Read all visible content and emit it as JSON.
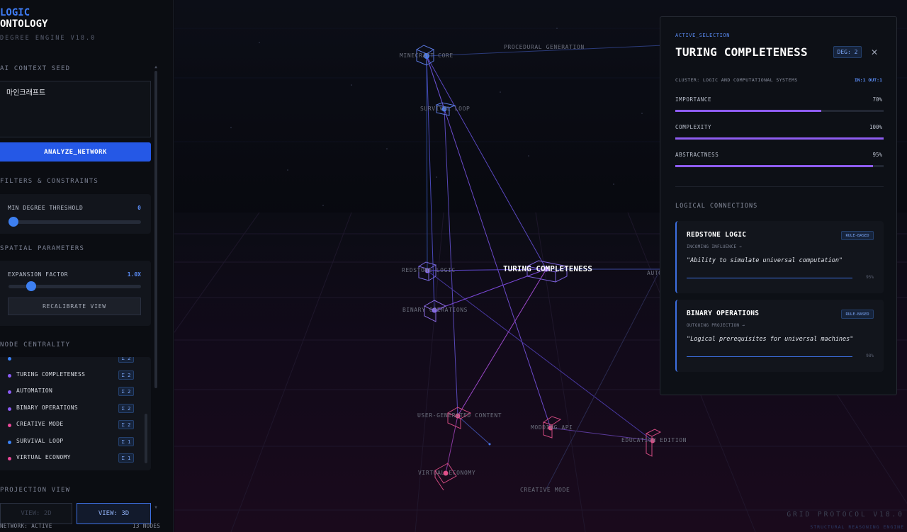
{
  "brand": {
    "line1": "LOGIC",
    "line2": "ONTOLOGY",
    "line3": "DEGREE ENGINE V18.0"
  },
  "sidebar": {
    "seed_title": "AI CONTEXT SEED",
    "seed_value": "마인크래프트",
    "analyze_label": "ANALYZE_NETWORK",
    "filters_title": "FILTERS & CONSTRAINTS",
    "min_degree_label": "MIN DEGREE THRESHOLD",
    "min_degree_value": "0",
    "spatial_title": "SPATIAL PARAMETERS",
    "expansion_label": "EXPANSION FACTOR",
    "expansion_value": "1.0X",
    "recalibrate_label": "RECALIBRATE VIEW",
    "centrality_title": "NODE CENTRALITY",
    "centrality": [
      {
        "label": "TURING COMPLETENESS",
        "badge": "Σ 2",
        "color": "#8b5cf6"
      },
      {
        "label": "AUTOMATION",
        "badge": "Σ 2",
        "color": "#8b5cf6"
      },
      {
        "label": "BINARY OPERATIONS",
        "badge": "Σ 2",
        "color": "#8b5cf6"
      },
      {
        "label": "CREATIVE MODE",
        "badge": "Σ 2",
        "color": "#ec4899"
      },
      {
        "label": "SURVIVAL LOOP",
        "badge": "Σ 1",
        "color": "#3b82f6"
      },
      {
        "label": "VIRTUAL ECONOMY",
        "badge": "Σ 1",
        "color": "#ec4899"
      }
    ],
    "projection_title": "PROJECTION VIEW",
    "view_2d": "VIEW: 2D",
    "view_3d": "VIEW: 3D",
    "status_network": "NETWORK: ACTIVE",
    "status_nodes": "13 NODES"
  },
  "scene": {
    "labels": {
      "minecraft_core": "MINECRAFT CORE",
      "procedural": "PROCEDURAL GENERATION",
      "survival": "SURVIVAL LOOP",
      "redstone": "REDSTONE LOGIC",
      "binary": "BINARY OPERATIONS",
      "turing": "TURING COMPLETENESS",
      "automation": "AUTOMATION",
      "ugc": "USER-GENERATED CONTENT",
      "modding": "MODDING API",
      "education": "EDUCATION EDITION",
      "virtual_economy": "VIRTUAL ECONOMY",
      "creative": "CREATIVE MODE"
    },
    "footer_brand": "GRID PROTOCOL V18.0",
    "footer_sub": "STRUCTURAL REASONING ENGINE"
  },
  "panel": {
    "kicker": "ACTIVE_SELECTION",
    "title": "TURING COMPLETENESS",
    "degree": "DEG: 2",
    "cluster": "CLUSTER: LOGIC AND COMPUTATIONAL SYSTEMS",
    "inout": "IN:1 OUT:1",
    "metrics": [
      {
        "label": "IMPORTANCE",
        "value": "70%",
        "fraction": 0.7
      },
      {
        "label": "COMPLEXITY",
        "value": "100%",
        "fraction": 1.0
      },
      {
        "label": "ABSTRACTNESS",
        "value": "95%",
        "fraction": 0.95
      }
    ],
    "connections_title": "LOGICAL CONNECTIONS",
    "connections": [
      {
        "name": "REDSTONE LOGIC",
        "tag": "RULE-BASED",
        "direction": "INCOMING INFLUENCE ←",
        "quote": "\"Ability to simulate universal computation\"",
        "strength": "95%"
      },
      {
        "name": "BINARY OPERATIONS",
        "tag": "RULE-BASED",
        "direction": "OUTGOING PROJECTION →",
        "quote": "\"Logical prerequisites for universal machines\"",
        "strength": "98%"
      }
    ]
  },
  "colors": {
    "accent": "#2558e6",
    "violet": "#8e5cf0",
    "pink": "#ec4899",
    "blue": "#3b82f6"
  }
}
